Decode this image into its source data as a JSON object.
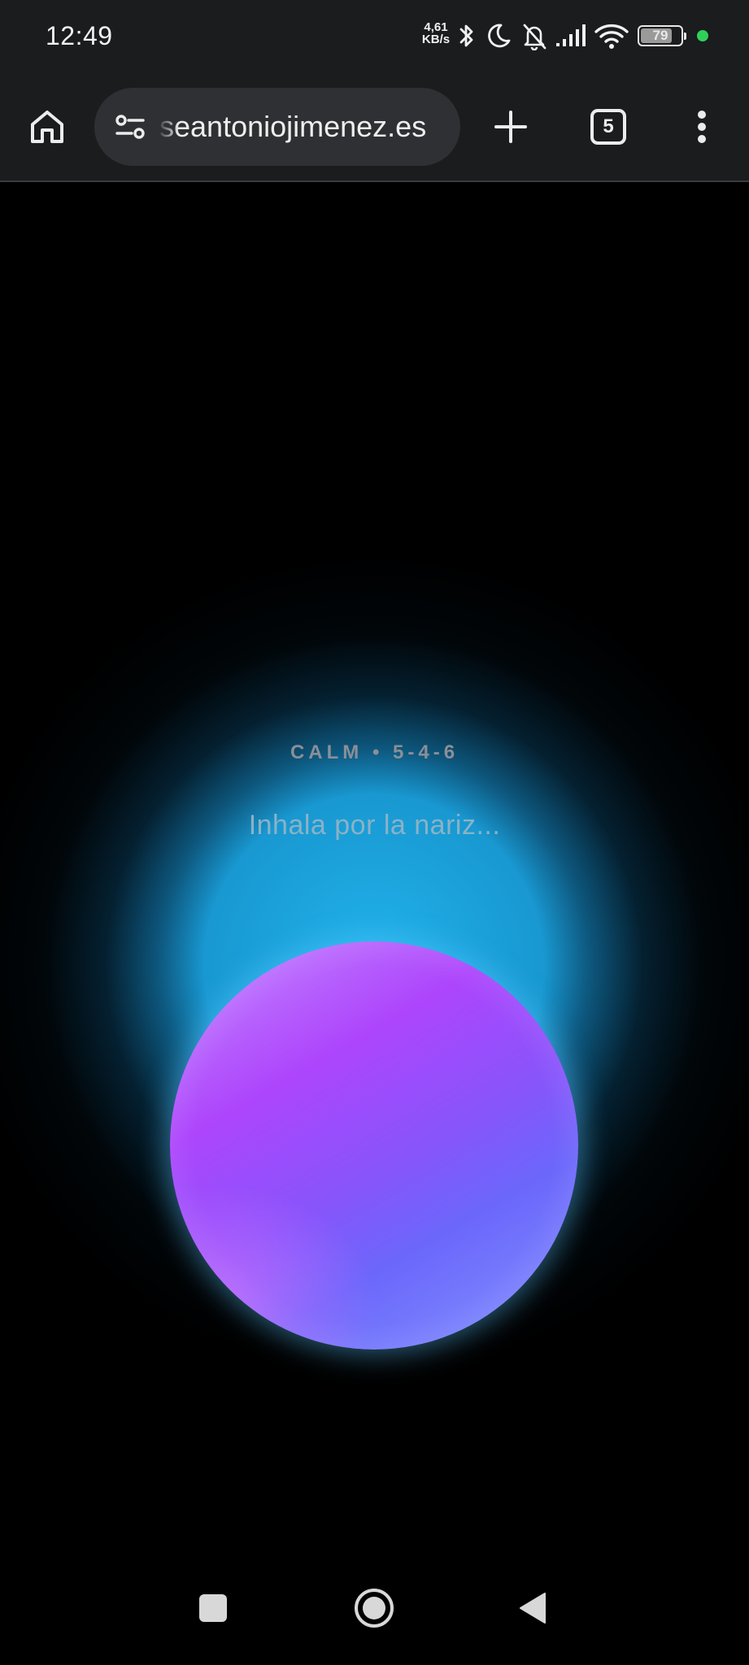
{
  "status_bar": {
    "time": "12:49",
    "net_speed_value": "4,61",
    "net_speed_unit": "KB/s",
    "battery_level": "79",
    "icons": [
      "bluetooth-icon",
      "moon-icon",
      "bell-off-icon",
      "cellular-signal-icon",
      "wifi-icon",
      "battery-icon",
      "privacy-indicator-dot"
    ],
    "indicator_color": "#2fd05a"
  },
  "browser": {
    "url": "seantoniojimenez.es",
    "tab_count": "5",
    "icons": [
      "home-icon",
      "site-settings-icon",
      "plus-icon",
      "tab-switcher-icon",
      "more-vert-icon"
    ]
  },
  "breathing": {
    "pattern": "CALM • 5-4-6",
    "instruction": "Inhala por la nariz...",
    "colors": {
      "glow": "#21b2eb",
      "orb_top": "#c68cff",
      "orb_mid": "#ad45fc",
      "orb_bottom": "#6b67fb",
      "label": "#8a8f98",
      "instruction": "#8ab2c7"
    }
  },
  "nav_bar": {
    "icons": [
      "recents-square-icon",
      "home-circle-icon",
      "back-triangle-icon"
    ]
  }
}
